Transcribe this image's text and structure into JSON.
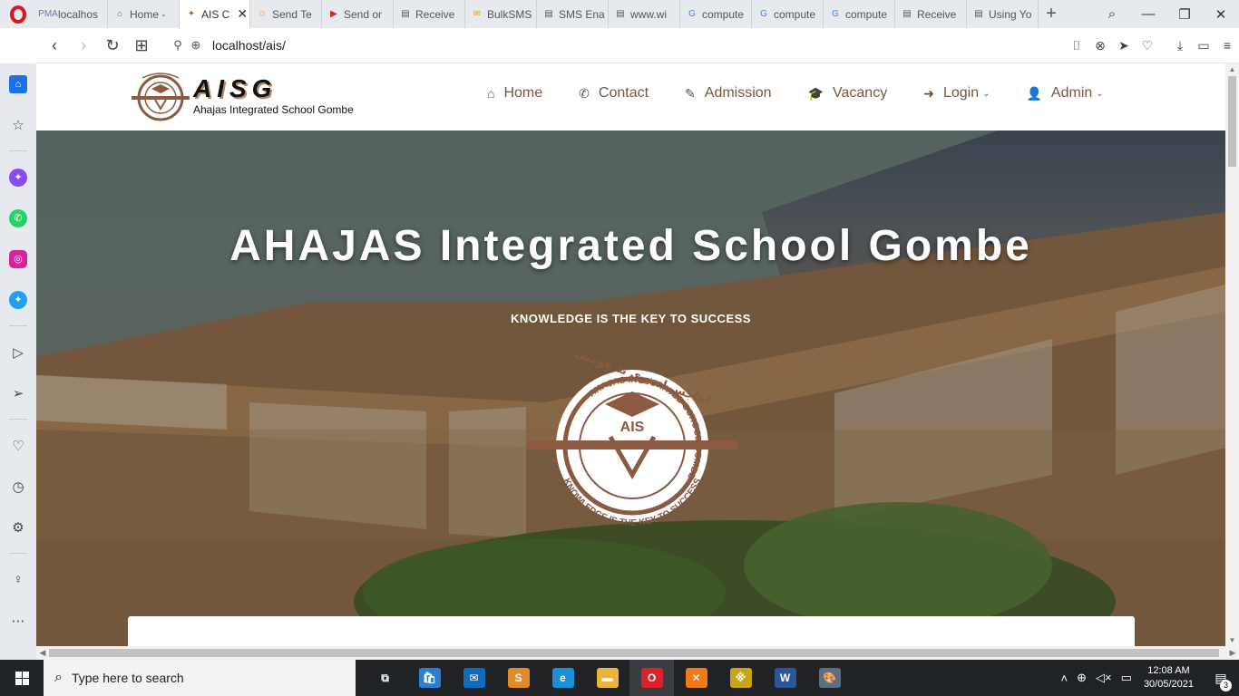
{
  "browser": {
    "tabs": [
      {
        "label": "localhos",
        "icon": "phpmyadmin-icon",
        "icon_text": "PMA",
        "color": "#6c78af"
      },
      {
        "label": "Home -",
        "icon": "school-icon",
        "icon_text": "⌂",
        "color": "#4a8a3a"
      },
      {
        "label": "AIS C",
        "icon": "ais-favicon-icon",
        "icon_text": "✦",
        "color": "#9b6a4d",
        "active": true
      },
      {
        "label": "Send Te",
        "icon": "chat-icon",
        "icon_text": "☺",
        "color": "#f39a1a"
      },
      {
        "label": "Send or",
        "icon": "youtube-icon",
        "icon_text": "▶",
        "color": "#e02020"
      },
      {
        "label": "Receive",
        "icon": "document-icon",
        "icon_text": "▤",
        "color": "#555555"
      },
      {
        "label": "BulkSMS",
        "icon": "mail-icon",
        "icon_text": "✉",
        "color": "#e8a316"
      },
      {
        "label": "SMS Ena",
        "icon": "document-icon",
        "icon_text": "▤",
        "color": "#555555"
      },
      {
        "label": "www.wi",
        "icon": "document-icon",
        "icon_text": "▤",
        "color": "#555555"
      },
      {
        "label": "compute",
        "icon": "google-icon",
        "icon_text": "G",
        "color": "#4285f4"
      },
      {
        "label": "compute",
        "icon": "google-icon",
        "icon_text": "G",
        "color": "#4285f4"
      },
      {
        "label": "compute",
        "icon": "google-icon",
        "icon_text": "G",
        "color": "#4285f4"
      },
      {
        "label": "Receive",
        "icon": "document-icon",
        "icon_text": "▤",
        "color": "#555555"
      },
      {
        "label": "Using Yo",
        "icon": "document-icon",
        "icon_text": "▤",
        "color": "#555555"
      }
    ],
    "close_tab_glyph": "✕",
    "new_tab_glyph": "+",
    "url": "localhost/ais/",
    "window": {
      "minimize": "—",
      "maximize": "❐",
      "close": "✕"
    }
  },
  "site": {
    "brand_title": "AISG",
    "brand_subtitle": "Ahajas Integrated School Gombe",
    "menu": [
      {
        "label": "Home",
        "icon": "home-icon",
        "glyph": "⌂"
      },
      {
        "label": "Contact",
        "icon": "phone-icon",
        "glyph": "✆"
      },
      {
        "label": "Admission",
        "icon": "edit-icon",
        "glyph": "✎"
      },
      {
        "label": "Vacancy",
        "icon": "graduation-cap-icon",
        "glyph": "🎓"
      },
      {
        "label": "Login",
        "icon": "sign-in-icon",
        "glyph": "➜",
        "dropdown": true
      },
      {
        "label": "Admin",
        "icon": "user-icon",
        "glyph": "👤",
        "dropdown": true
      }
    ],
    "hero_title": "AHAJAS Integrated School Gombe",
    "hero_tagline": "KNOWLEDGE IS THE KEY TO SUCCESS",
    "emblem_ring_text": "AHAJAS INTEGRATED SCHOOL GOMBE",
    "emblem_motto": "KNOWLEDGE IS THE KEY TO SUCCESS",
    "emblem_center": "AIS",
    "emblem_arabic": "اهاجس انتغري تد غومبي",
    "accent_color": "#7a5640"
  },
  "taskbar": {
    "search_placeholder": "Type here to search",
    "time": "12:08 AM",
    "date": "30/05/2021",
    "notifications": "3",
    "apps": [
      {
        "name": "task-view",
        "glyph": "⧉",
        "color": "#202326"
      },
      {
        "name": "store",
        "glyph": "🛍",
        "color": "#2d7dd2"
      },
      {
        "name": "mail",
        "glyph": "✉",
        "color": "#0f6cbd"
      },
      {
        "name": "sublime-text",
        "glyph": "S",
        "color": "#e48a26"
      },
      {
        "name": "edge",
        "glyph": "e",
        "color": "#1b8fd8"
      },
      {
        "name": "file-explorer",
        "glyph": "▬",
        "color": "#e9b53f"
      },
      {
        "name": "opera",
        "glyph": "O",
        "color": "#d8232a",
        "active": true
      },
      {
        "name": "xampp",
        "glyph": "✕",
        "color": "#f07b17"
      },
      {
        "name": "winrar",
        "glyph": "※",
        "color": "#c8a41b"
      },
      {
        "name": "word",
        "glyph": "W",
        "color": "#2b579a"
      },
      {
        "name": "paint",
        "glyph": "🎨",
        "color": "#5a6f86"
      }
    ]
  }
}
